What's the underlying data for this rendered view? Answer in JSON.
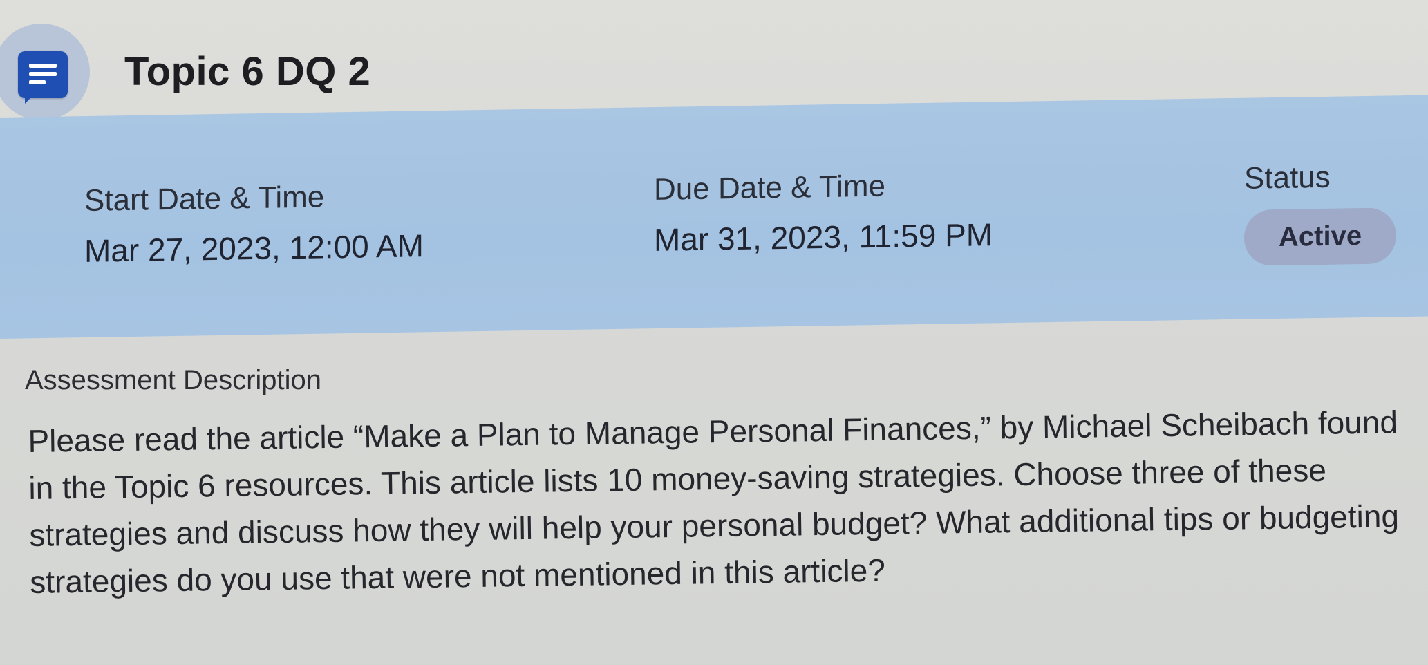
{
  "header": {
    "icon": "discussion-icon",
    "title": "Topic 6 DQ 2"
  },
  "info": {
    "start": {
      "label": "Start Date & Time",
      "value": "Mar 27, 2023, 12:00 AM"
    },
    "due": {
      "label": "Due Date & Time",
      "value": "Mar 31, 2023, 11:59 PM"
    },
    "status": {
      "label": "Status",
      "value": "Active"
    }
  },
  "description": {
    "heading": "Assessment Description",
    "body": "Please read the article “Make a Plan to Manage Personal Finances,” by Michael Scheibach found in the Topic 6 resources. This article lists 10 money-saving strategies. Choose three of these strategies and discuss how they will help your personal budget? What additional tips or budgeting strategies do you use that were not mentioned in this article?"
  },
  "colors": {
    "accent": "#1f4fb3",
    "band": "#a9c6e3",
    "badge": "#9fa9c8"
  }
}
